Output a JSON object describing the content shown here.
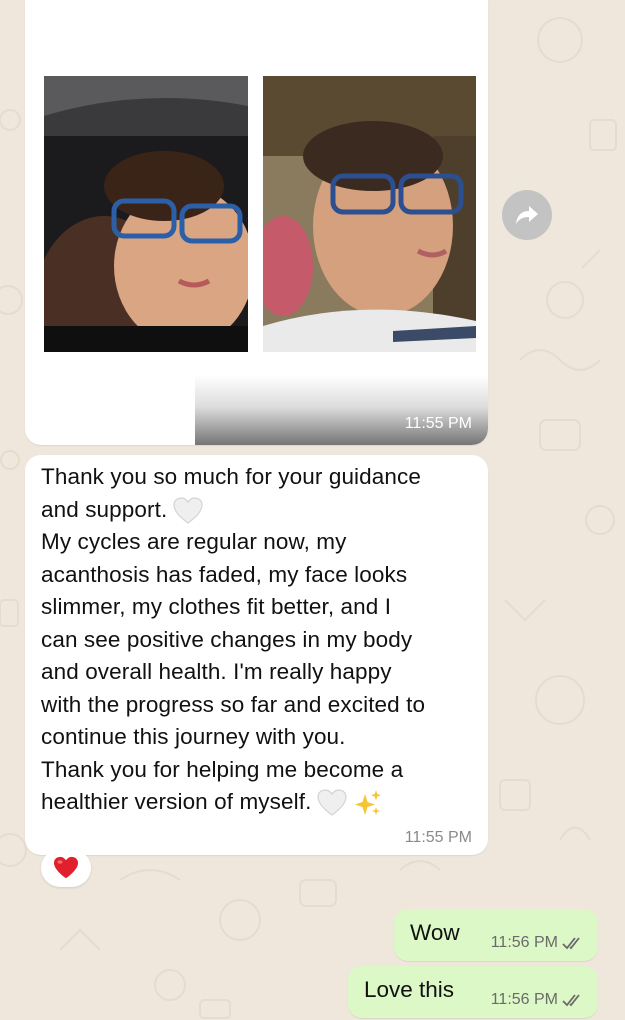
{
  "image_message": {
    "time": "11:55 PM",
    "photos": [
      "photo-left",
      "photo-right"
    ]
  },
  "text_message": {
    "lines": [
      "Thank you so much for your guidance",
      "and support.",
      "My cycles are regular now, my",
      "acanthosis has faded, my face looks",
      "slimmer, my clothes fit better, and I",
      "can see positive changes in my body",
      "and overall health. I'm really happy",
      "with the progress so far and excited to",
      "continue this journey with you.",
      "Thank you for helping me become a",
      "healthier version of myself."
    ],
    "time": "11:55 PM",
    "reaction": "red-heart-emoji"
  },
  "outgoing": [
    {
      "text": "Wow",
      "time": "11:56 PM",
      "status": "read-double-check"
    },
    {
      "text": "Love this",
      "time": "11:56 PM",
      "status": "read-double-check"
    }
  ],
  "colors": {
    "background": "#efe7dc",
    "incoming_bubble": "#ffffff",
    "outgoing_bubble": "#dcf8c6",
    "forward_button": "#c3c3c3"
  }
}
